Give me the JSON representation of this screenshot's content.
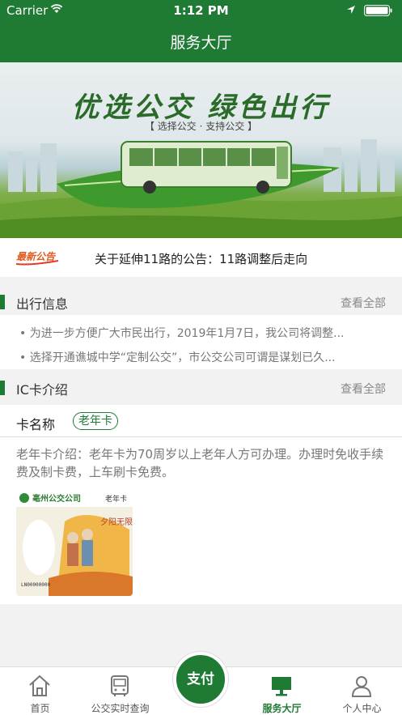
{
  "status_bar": {
    "carrier": "Carrier",
    "time": "1:12 PM"
  },
  "nav": {
    "title": "服务大厅"
  },
  "banner": {
    "slogan": "优选公交  绿色出行",
    "subtitle": "【 选择公交 · 支持公交 】"
  },
  "notice": {
    "tag": "最新公告",
    "text": "关于延伸11路的公告：11路调整后走向"
  },
  "travel_info": {
    "title": "出行信息",
    "more": "查看全部",
    "items": [
      "为进一步方便广大市民出行，2019年1月7日，我公司将调整...",
      "选择开通谯城中学“定制公交”，市公交公司可谓是谋划已久..."
    ]
  },
  "ic_card": {
    "title": "IC卡介绍",
    "more": "查看全部",
    "name_label": "卡名称",
    "card_type": "老年卡",
    "description": "老年卡介绍：老年卡为70周岁以上老年人方可办理。办理时免收手续费及制卡费，上车刷卡免费。",
    "card_image": {
      "company": "亳州公交公司",
      "type": "老年卡",
      "motto": "夕阳无限好",
      "number": "LN00000000"
    }
  },
  "tabbar": {
    "tabs": [
      {
        "label": "首页",
        "icon": "home-icon"
      },
      {
        "label": "公交实时查询",
        "icon": "bus-icon"
      },
      {
        "label": "支付",
        "icon": "pay-button"
      },
      {
        "label": "服务大厅",
        "icon": "monitor-icon"
      },
      {
        "label": "个人中心",
        "icon": "user-icon"
      }
    ],
    "active_color": "#1f7a34"
  }
}
